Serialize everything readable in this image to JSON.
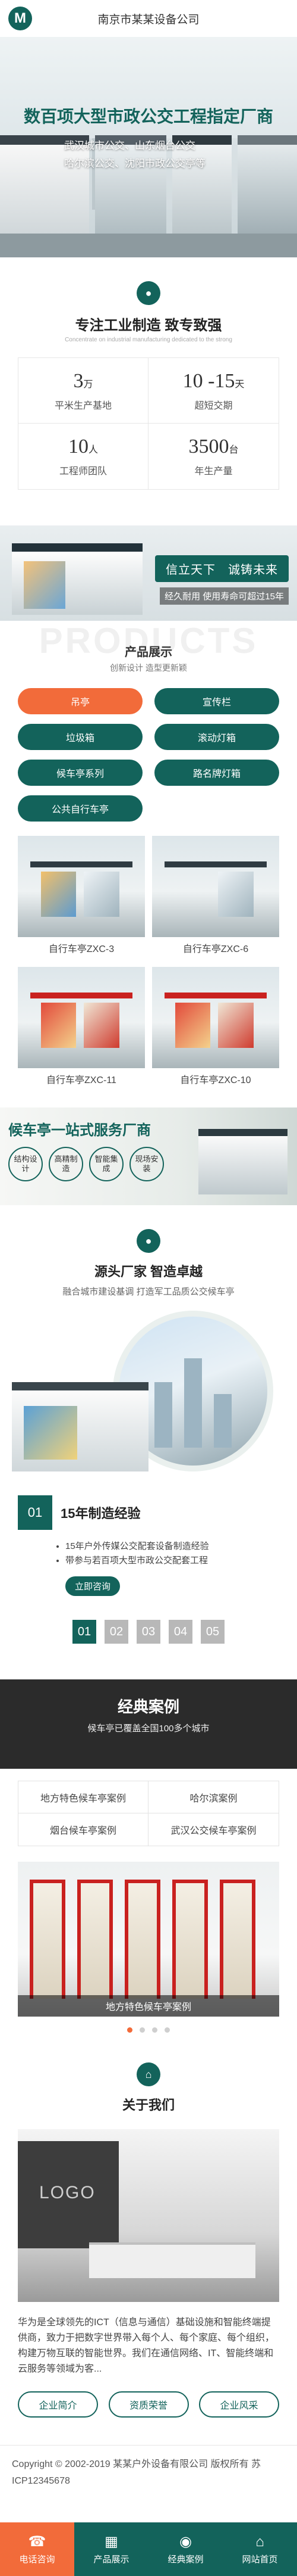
{
  "header": {
    "site_title": "南京市某某设备公司",
    "logo_letter": "M"
  },
  "hero": {
    "title": "数百项大型市政公交工程指定厂商",
    "line1": "武汉城市公交、山东烟台公交",
    "line2": "哈尔滨公交、沈阳市政公交亭等"
  },
  "feature": {
    "title": "专注工业制造 致专致强",
    "subtitle": "Concentrate on industrial manufacturing dedicated to the strong",
    "stats": [
      {
        "num": "3",
        "unit": "万",
        "label": "平米生产基地"
      },
      {
        "num": "10 -15",
        "unit": "天",
        "label": "超短交期"
      },
      {
        "num": "10",
        "unit": "人",
        "label": "工程师团队"
      },
      {
        "num": "3500",
        "unit": "台",
        "label": "年生产量"
      }
    ]
  },
  "banner": {
    "tag": "信立天下　诚铸未来",
    "sub": "经久耐用 使用寿命可超过15年"
  },
  "products": {
    "bg_word": "PRODUCTS",
    "title": "产品展示",
    "subtitle": "创新设计 造型更新颖",
    "categories": [
      "吊亭",
      "宣传栏",
      "垃圾箱",
      "滚动灯箱",
      "候车亭系列",
      "路名牌灯箱",
      "公共自行车亭"
    ],
    "items": [
      {
        "caption": "自行车亭ZXC-3"
      },
      {
        "caption": "自行车亭ZXC-6"
      },
      {
        "caption": "自行车亭ZXC-11"
      },
      {
        "caption": "自行车亭ZXC-10"
      }
    ]
  },
  "service": {
    "title": "候车亭一站式服务厂商",
    "tags": [
      "结构设计",
      "高精制造",
      "智能集成",
      "现场安装"
    ]
  },
  "source": {
    "title": "源头厂家 智造卓越",
    "subtitle": "融合城市建设基调 打造军工品质公交候车亭",
    "exp_num": "01",
    "exp_title": "15年制造经验",
    "exp_items": [
      "15年户外传媒公交配套设备制造经验",
      "带参与若百项大型市政公交配套工程"
    ],
    "consult": "立即咨询",
    "pages": [
      "01",
      "02",
      "03",
      "04",
      "05"
    ]
  },
  "cases": {
    "title": "经典案例",
    "subtitle": "候车亭已覆盖全国100多个城市",
    "links": [
      "地方特色候车亭案例",
      "哈尔滨案例",
      "烟台候车亭案例",
      "武汉公交候车亭案例"
    ],
    "caption": "地方特色候车亭案例"
  },
  "about": {
    "title": "关于我们",
    "logo_text": "LOGO",
    "text": "华为是全球领先的ICT（信息与通信）基础设施和智能终端提供商，致力于把数字世界带入每个人、每个家庭、每个组织，构建万物互联的智能世界。我们在通信网络、IT、智能终端和云服务等领域为客...",
    "buttons": [
      "企业简介",
      "资质荣誉",
      "企业风采"
    ]
  },
  "footer": {
    "copyright": "Copyright © 2002-2019 某某户外设备有限公司 版权所有 苏ICP12345678"
  },
  "bottom_nav": [
    {
      "label": "电话咨询",
      "icon": "☎"
    },
    {
      "label": "产品展示",
      "icon": "▦"
    },
    {
      "label": "经典案例",
      "icon": "◉"
    },
    {
      "label": "网站首页",
      "icon": "⌂"
    }
  ],
  "colors": {
    "brand": "#13635b",
    "accent": "#f26b3a"
  }
}
